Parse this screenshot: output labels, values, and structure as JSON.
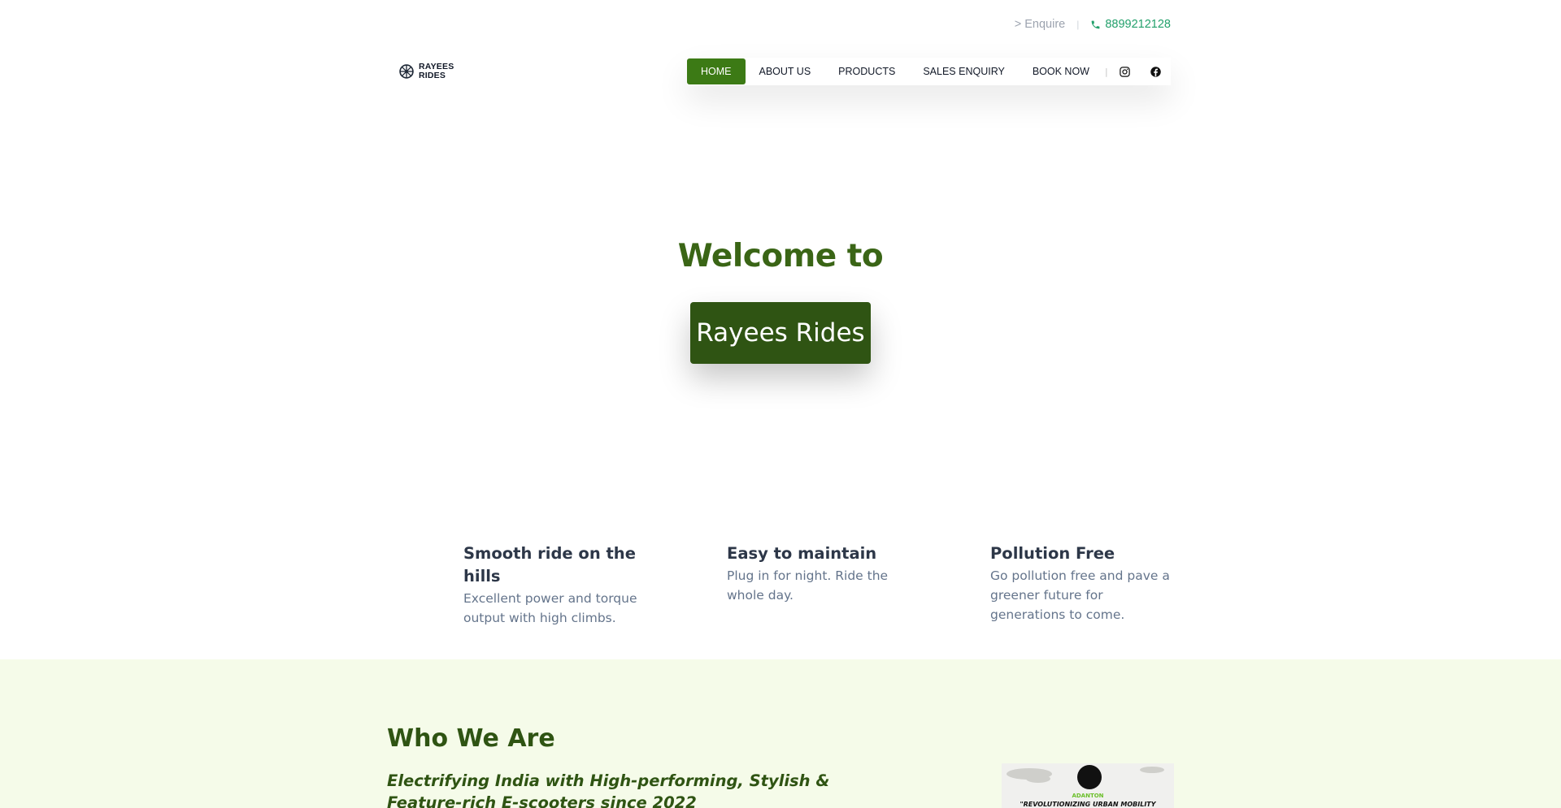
{
  "topbar": {
    "enquire": "> Enquire",
    "separator": "|",
    "phone": "8899212128"
  },
  "logo": {
    "line1": "RAYEES",
    "line2": "RIDES",
    "icon": "wheel-icon"
  },
  "nav": {
    "items": [
      {
        "label": "HOME",
        "active": true
      },
      {
        "label": "ABOUT US",
        "active": false
      },
      {
        "label": "PRODUCTS",
        "active": false
      },
      {
        "label": "SALES ENQUIRY",
        "active": false
      },
      {
        "label": "BOOK NOW",
        "active": false
      }
    ],
    "separator": "|",
    "social": [
      "instagram-icon",
      "facebook-icon"
    ]
  },
  "hero": {
    "welcome": "Welcome to",
    "brand": "Rayees Rides"
  },
  "features": [
    {
      "title": "Smooth ride on the hills",
      "desc": "Excellent power and torque output with high climbs."
    },
    {
      "title": "Easy to maintain",
      "desc": "Plug in for night. Ride the whole day."
    },
    {
      "title": "Pollution Free",
      "desc": "Go pollution free and pave a greener future for generations to come."
    }
  ],
  "who": {
    "heading_light": "Who ",
    "heading_strong": "We Are",
    "tagline": "Electrifying India with High-performing, Stylish & Feature-rich E-scooters since 2022",
    "image_brand": "ADANTON",
    "image_slogan": "\"REVOLUTIONIZING URBAN MOBILITY"
  },
  "colors": {
    "primary_green": "#3c7a15",
    "dark_green": "#2f5413",
    "phone_green": "#22a06b",
    "section_bg": "#f5fbe9"
  }
}
